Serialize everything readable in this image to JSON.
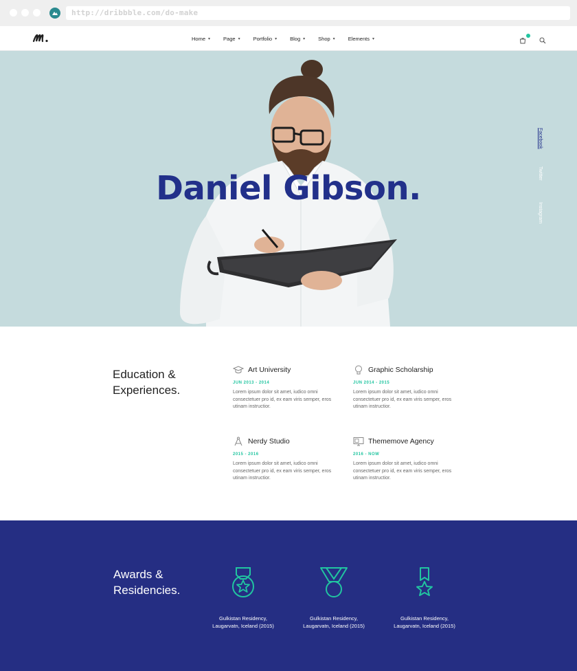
{
  "browser": {
    "url": "http://dribbble.com/do-make"
  },
  "nav": {
    "items": [
      {
        "label": "Home"
      },
      {
        "label": "Page"
      },
      {
        "label": "Portfolio"
      },
      {
        "label": "Blog"
      },
      {
        "label": "Shop"
      },
      {
        "label": "Elements"
      }
    ]
  },
  "hero": {
    "title": "Daniel Gibson.",
    "social": [
      "Facebook",
      "Twitter",
      "Instagram"
    ]
  },
  "education": {
    "heading_line1": "Education &",
    "heading_line2": "Experiences.",
    "items": [
      {
        "title": "Art University",
        "date": "JUN 2013 - 2014",
        "desc": "Lorem ipsum dolor sit amet, iudico omni consectetuer pro id, ex eam viris semper, eros utinam instructior.",
        "icon": "graduation-cap-icon"
      },
      {
        "title": "Graphic Scholarship",
        "date": "JUN 2014 - 2015",
        "desc": "Lorem ipsum dolor sit amet, iudico omni consectetuer pro id, ex eam viris semper, eros utinam instructior.",
        "icon": "lightbulb-icon"
      },
      {
        "title": "Nerdy Studio",
        "date": "2015 - 2016",
        "desc": "Lorem ipsum dolor sit amet, iudico omni consectetuer pro id, ex eam viris semper, eros utinam instructior.",
        "icon": "compass-icon"
      },
      {
        "title": "Thememove Agency",
        "date": "2016 - NOW",
        "desc": "Lorem ipsum dolor sit amet, iudico omni consectetuer pro id, ex eam viris semper, eros utinam instructior.",
        "icon": "monitor-icon"
      }
    ]
  },
  "awards": {
    "heading_line1": "Awards &",
    "heading_line2": "Residencies.",
    "items": [
      {
        "line1": "Gulkistan Residency,",
        "line2": "Laugarvatn, Iceland (2015)",
        "icon": "medal-star-icon"
      },
      {
        "line1": "Gulkistan Residency,",
        "line2": "Laugarvatn, Iceland (2015)",
        "icon": "medal-ribbon-icon"
      },
      {
        "line1": "Gulkistan Residency,",
        "line2": "Laugarvatn, Iceland (2015)",
        "icon": "star-ribbon-icon"
      }
    ]
  },
  "colors": {
    "accent_navy": "#252e83",
    "accent_teal": "#21c5a0",
    "hero_bg": "#c5dbdd"
  }
}
